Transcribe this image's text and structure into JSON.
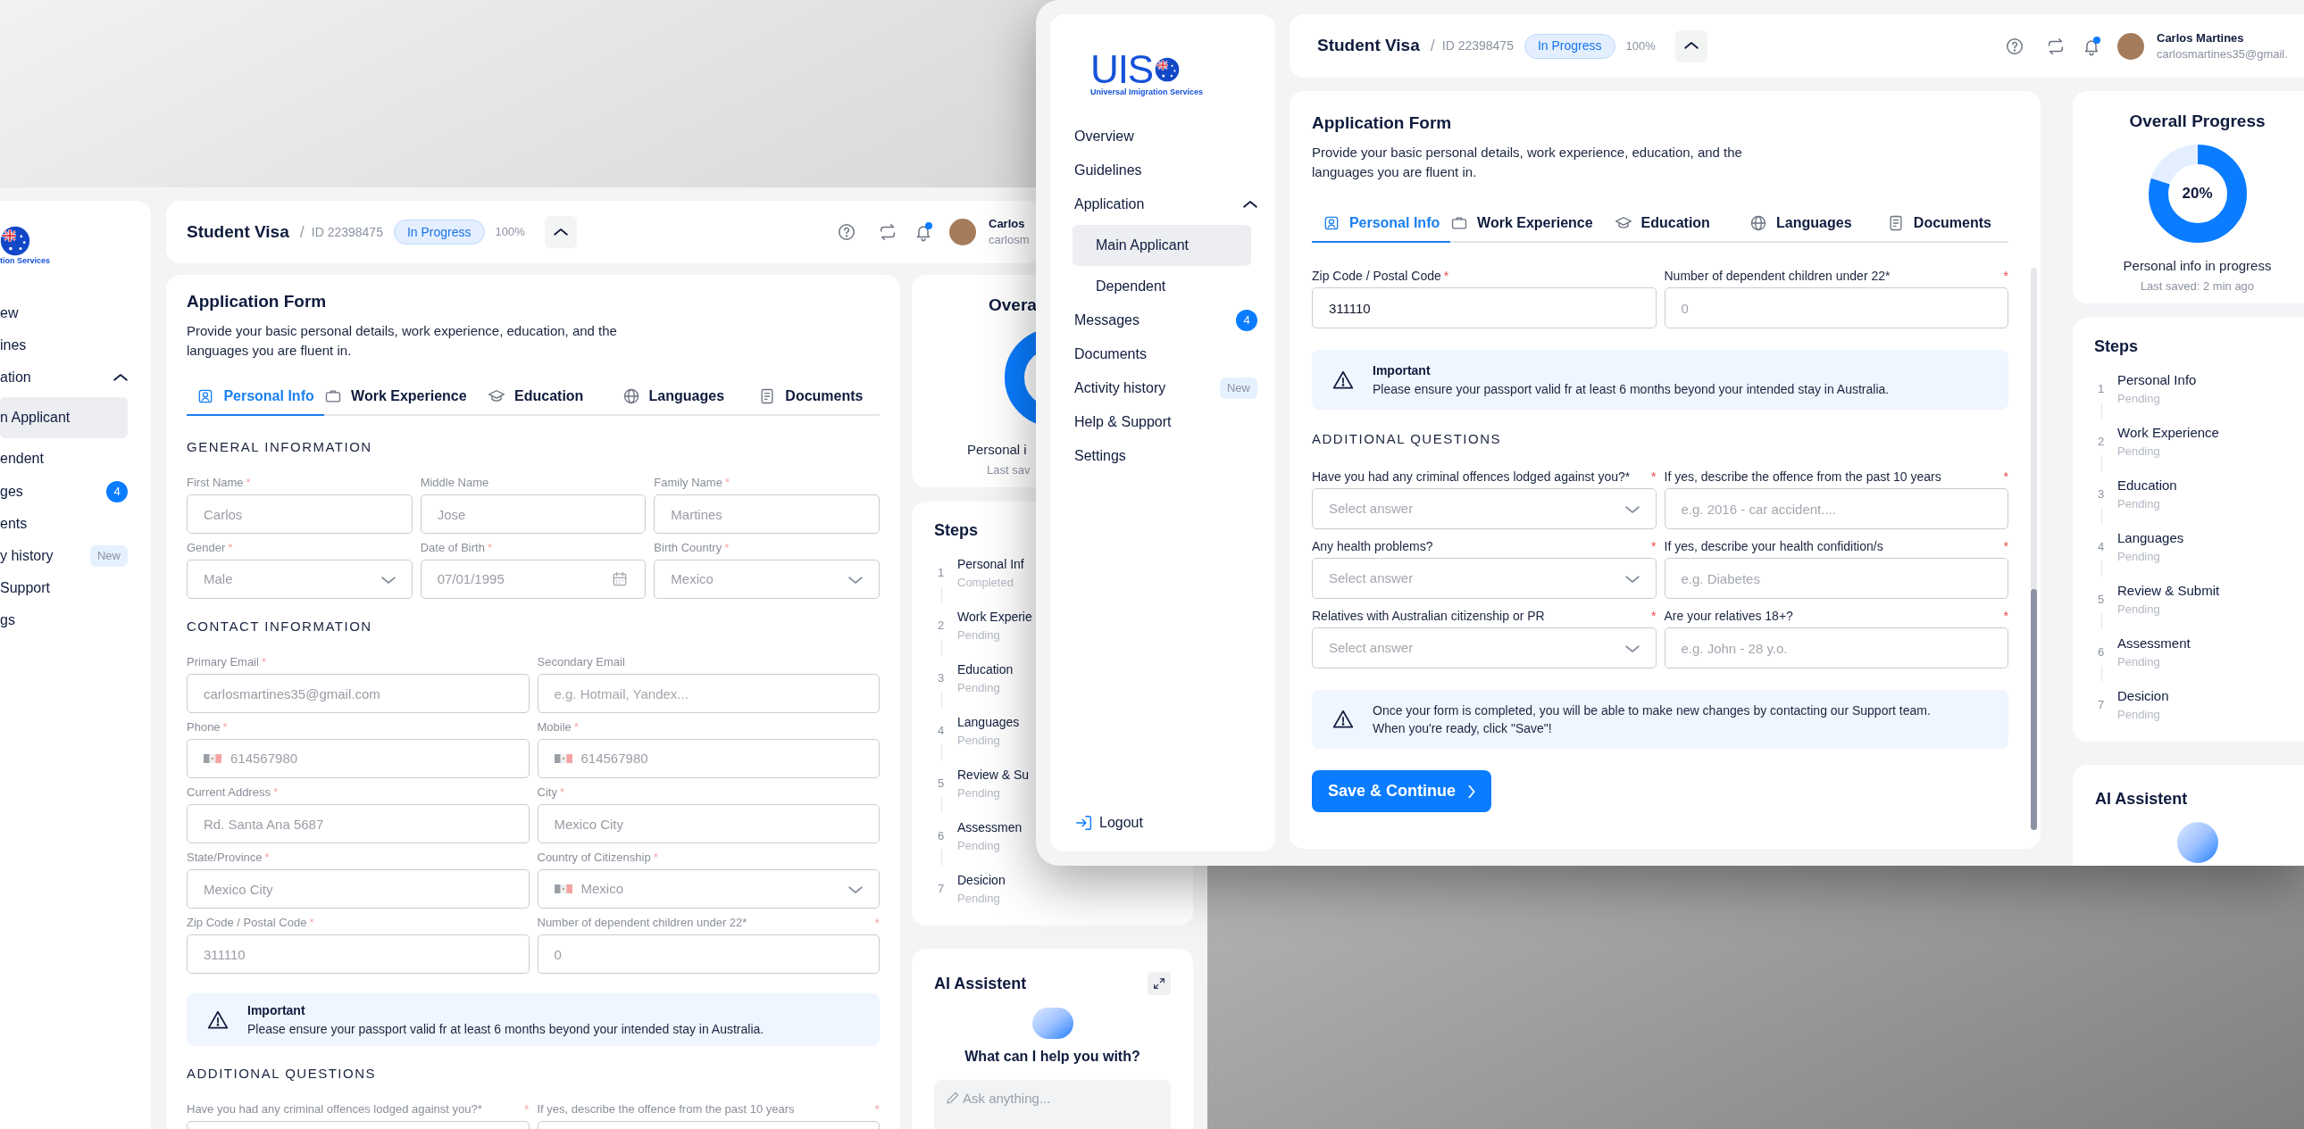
{
  "back_window": {
    "logo": {
      "subtitle": "tion Services"
    },
    "sidebar": {
      "items": [
        {
          "label": "ew",
          "selected": false
        },
        {
          "label": "ines",
          "selected": false
        },
        {
          "label": "ation",
          "selected": false,
          "expanded": true,
          "children": [
            {
              "label": "n Applicant",
              "selected": true
            },
            {
              "label": "endent",
              "selected": false
            }
          ]
        },
        {
          "label": "ges",
          "selected": false,
          "badge": {
            "kind": "count",
            "text": "4"
          }
        },
        {
          "label": "ents",
          "selected": false
        },
        {
          "label": "y history",
          "selected": false,
          "badge": {
            "kind": "tag",
            "text": "New"
          }
        },
        {
          "label": "Support",
          "selected": false
        },
        {
          "label": "gs",
          "selected": false
        }
      ]
    },
    "header": {
      "title": "Student Visa",
      "separator": "/",
      "id": "ID 22398475",
      "status": "In Progress",
      "percent": "100%",
      "expanded": true,
      "notification": true,
      "user": {
        "name": "Carlos",
        "email": "carlosm"
      }
    },
    "form": {
      "title": "Application Form",
      "description": "Provide your basic personal details, work experience, education, and the languages you are fluent in.",
      "locked": true,
      "tabs": [
        {
          "label": "Personal Info",
          "selected": true
        },
        {
          "label": "Work Experience",
          "selected": false
        },
        {
          "label": "Education",
          "selected": false
        },
        {
          "label": "Languages",
          "selected": false
        },
        {
          "label": "Documents",
          "selected": false
        }
      ],
      "blocks": [
        {
          "kind": "heading",
          "text": "GENERAL INFORMATION"
        },
        {
          "kind": "field_grid_3",
          "fields": [
            {
              "label": "First Name",
              "asterisk": "*",
              "kind": "text",
              "value": "Carlos"
            },
            {
              "label": "Middle Name",
              "kind": "text",
              "value": "Jose"
            },
            {
              "label": "Family Name",
              "asterisk": "*",
              "kind": "text",
              "value": "Martines"
            },
            {
              "label": "Gender",
              "asterisk": "*",
              "kind": "select",
              "value": "Male"
            },
            {
              "label": "Date of Birth",
              "asterisk": "*",
              "kind": "date",
              "value": "07/01/1995"
            },
            {
              "label": "Birth Country",
              "asterisk": "*",
              "kind": "select",
              "value": "Mexico"
            }
          ]
        },
        {
          "kind": "heading",
          "text": "CONTACT INFORMATION"
        },
        {
          "kind": "field_grid_2",
          "fields": [
            {
              "label": "Primary Email",
              "asterisk": "*",
              "kind": "text",
              "value": "carlosmartines35@gmail.com"
            },
            {
              "label": "Secondary Email",
              "kind": "text",
              "placeholder": "e.g. Hotmail, Yandex..."
            },
            {
              "label": "Phone",
              "asterisk": "*",
              "kind": "phone",
              "value": "614567980"
            },
            {
              "label": "Mobile",
              "asterisk": "*",
              "kind": "phone",
              "value": "614567980"
            },
            {
              "label": "Current Address",
              "asterisk": "*",
              "kind": "text",
              "value": "Rd. Santa Ana 5687"
            },
            {
              "label": "City",
              "asterisk": "*",
              "kind": "text",
              "value": "Mexico City"
            },
            {
              "label": "State/Province",
              "asterisk": "*",
              "kind": "text",
              "value": "Mexico City"
            },
            {
              "label": "Country of Citizenship",
              "asterisk": "*",
              "kind": "country",
              "value": "Mexico"
            },
            {
              "label": "Zip Code / Postal Code",
              "asterisk": "*",
              "kind": "text",
              "value": "311110"
            },
            {
              "label": "Number of dependent children under 22*",
              "end_asterisk": "*",
              "kind": "text",
              "value": "0"
            }
          ]
        },
        {
          "kind": "notice",
          "title": "Important",
          "lines": [
            "Please ensure your passport valid fr at least 6 months beyond your intended stay in Australia."
          ]
        },
        {
          "kind": "heading",
          "text": "ADDITIONAL QUESTIONS"
        },
        {
          "kind": "field_grid_2",
          "fields": [
            {
              "label": "Have you had any criminal offences lodged against you?*",
              "end_asterisk": "*",
              "kind": "text"
            },
            {
              "label": "If yes, describe the offence from the past 10 years",
              "end_asterisk": "*",
              "kind": "text"
            }
          ]
        }
      ]
    },
    "progress": {
      "title": "Overa",
      "caption": "Personal i",
      "saved": "Last sav"
    },
    "steps": {
      "title": "Steps",
      "items": [
        {
          "number": "1",
          "name": "Personal Inf",
          "status": "Completed"
        },
        {
          "number": "2",
          "name": "Work Experie",
          "status": "Pending"
        },
        {
          "number": "3",
          "name": "Education",
          "status": "Pending"
        },
        {
          "number": "4",
          "name": "Languages",
          "status": "Pending"
        },
        {
          "number": "5",
          "name": "Review & Su",
          "status": "Pending"
        },
        {
          "number": "6",
          "name": "Assessmen",
          "status": "Pending"
        },
        {
          "number": "7",
          "name": "Desicion",
          "status": "Pending"
        }
      ]
    },
    "assistant": {
      "title": "AI Assistent",
      "expandable": true,
      "prompt": "What can I help you with?",
      "placeholder": "Ask anything..."
    }
  },
  "front_window": {
    "logo": {
      "text": "UIS",
      "subtitle": "Universal Imigration Services"
    },
    "sidebar": {
      "items": [
        {
          "label": "Overview",
          "selected": false
        },
        {
          "label": "Guidelines",
          "selected": false
        },
        {
          "label": "Application",
          "selected": false,
          "expanded": true,
          "children": [
            {
              "label": "Main Applicant",
              "selected": true
            },
            {
              "label": "Dependent",
              "selected": false
            }
          ]
        },
        {
          "label": "Messages",
          "selected": false,
          "badge": {
            "kind": "count",
            "text": "4"
          }
        },
        {
          "label": "Documents",
          "selected": false
        },
        {
          "label": "Activity history",
          "selected": false,
          "badge": {
            "kind": "tag",
            "text": "New"
          }
        },
        {
          "label": "Help & Support",
          "selected": false
        },
        {
          "label": "Settings",
          "selected": false
        }
      ],
      "logout": "Logout"
    },
    "header": {
      "title": "Student Visa",
      "separator": "/",
      "id": "ID 22398475",
      "status": "In Progress",
      "percent": "100%",
      "expanded": true,
      "notification": true,
      "user": {
        "name": "Carlos Martines",
        "email": "carlosmartines35@gmail."
      }
    },
    "form": {
      "title": "Application Form",
      "description": "Provide your basic personal details, work experience, education, and the languages you are fluent in.",
      "locked": false,
      "tabs": [
        {
          "label": "Personal Info",
          "selected": true
        },
        {
          "label": "Work Experience",
          "selected": false
        },
        {
          "label": "Education",
          "selected": false
        },
        {
          "label": "Languages",
          "selected": false
        },
        {
          "label": "Documents",
          "selected": false
        }
      ],
      "blocks": [
        {
          "kind": "field_grid_2",
          "fields": [
            {
              "label": "Zip Code / Postal Code",
              "asterisk": "*",
              "kind": "text",
              "value": "311110"
            },
            {
              "label": "Number of dependent children under 22*",
              "end_asterisk": "*",
              "kind": "text",
              "placeholder": "0"
            }
          ]
        },
        {
          "kind": "notice",
          "title": "Important",
          "lines": [
            "Please ensure your passport valid fr at least 6 months beyond your intended stay in Australia."
          ]
        },
        {
          "kind": "heading",
          "text": "ADDITIONAL QUESTIONS"
        },
        {
          "kind": "field_grid_2",
          "fields": [
            {
              "label": "Have you had any criminal offences lodged against you?*",
              "end_asterisk": "*",
              "kind": "select",
              "placeholder": "Select answer"
            },
            {
              "label": "If yes, describe the offence from the past 10 years",
              "end_asterisk": "*",
              "kind": "text",
              "placeholder": "e.g. 2016 - car accident...."
            },
            {
              "label": "Any health problems?",
              "end_asterisk": "*",
              "kind": "select",
              "placeholder": "Select answer"
            },
            {
              "label": "If yes, describe your health confidition/s",
              "end_asterisk": "*",
              "kind": "text",
              "placeholder": "e.g. Diabetes"
            },
            {
              "label": "Relatives with Australian citizenship or PR",
              "end_asterisk": "*",
              "kind": "select",
              "placeholder": "Select answer"
            },
            {
              "label": "Are your relatives 18+?",
              "end_asterisk": "*",
              "kind": "text",
              "placeholder": "e.g. John - 28 y.o."
            }
          ]
        },
        {
          "kind": "notice",
          "lines": [
            "Once your form is completed, you will be able to make new changes by contacting our Support team.",
            "When you're ready, click \"Save\"!"
          ]
        },
        {
          "kind": "button",
          "label": "Save & Continue"
        }
      ]
    },
    "progress": {
      "title": "Overall Progress",
      "level": 0.8,
      "percent": "20%",
      "caption": "Personal info in progress",
      "saved": "Last saved: 2 min ago"
    },
    "steps": {
      "title": "Steps",
      "items": [
        {
          "number": "1",
          "name": "Personal Info",
          "status": "Pending"
        },
        {
          "number": "2",
          "name": "Work Experience",
          "status": "Pending"
        },
        {
          "number": "3",
          "name": "Education",
          "status": "Pending"
        },
        {
          "number": "4",
          "name": "Languages",
          "status": "Pending"
        },
        {
          "number": "5",
          "name": "Review & Submit",
          "status": "Pending"
        },
        {
          "number": "6",
          "name": "Assessment",
          "status": "Pending"
        },
        {
          "number": "7",
          "name": "Desicion",
          "status": "Pending"
        }
      ]
    },
    "assistant": {
      "title": "AI Assistent",
      "expandable": false
    }
  }
}
